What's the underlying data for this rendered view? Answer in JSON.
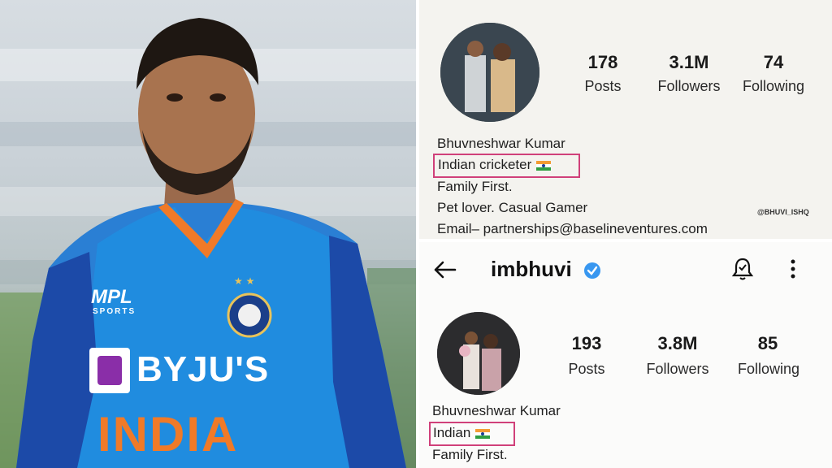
{
  "photo": {
    "jersey": {
      "sponsor_small": "MPL",
      "sponsor_small_sub": "SPORTS",
      "sponsor_main": "BYJU'S",
      "team": "INDIA"
    }
  },
  "old_profile": {
    "stats": [
      {
        "value": "178",
        "label": "Posts"
      },
      {
        "value": "3.1M",
        "label": "Followers"
      },
      {
        "value": "74",
        "label": "Following"
      }
    ],
    "name": "Bhuvneshwar Kumar",
    "bio_highlight": "Indian cricketer",
    "bio_lines": [
      "Family First.",
      "Pet lover. Casual Gamer",
      "Email– partnerships@baselineventures.com"
    ],
    "watermark": "@BHUVI_ISHQ"
  },
  "new_profile": {
    "username": "imbhuvi",
    "stats": [
      {
        "value": "193",
        "label": "Posts"
      },
      {
        "value": "3.8M",
        "label": "Followers"
      },
      {
        "value": "85",
        "label": "Following"
      }
    ],
    "name": "Bhuvneshwar Kumar",
    "bio_highlight": "Indian",
    "bio_lines": [
      "Family First."
    ]
  },
  "colors": {
    "highlight_box": "#d0407a",
    "verified_badge": "#3897f0"
  },
  "icons": [
    "back-arrow-icon",
    "verified-badge-icon",
    "bell-icon",
    "more-icon",
    "india-flag-icon"
  ]
}
